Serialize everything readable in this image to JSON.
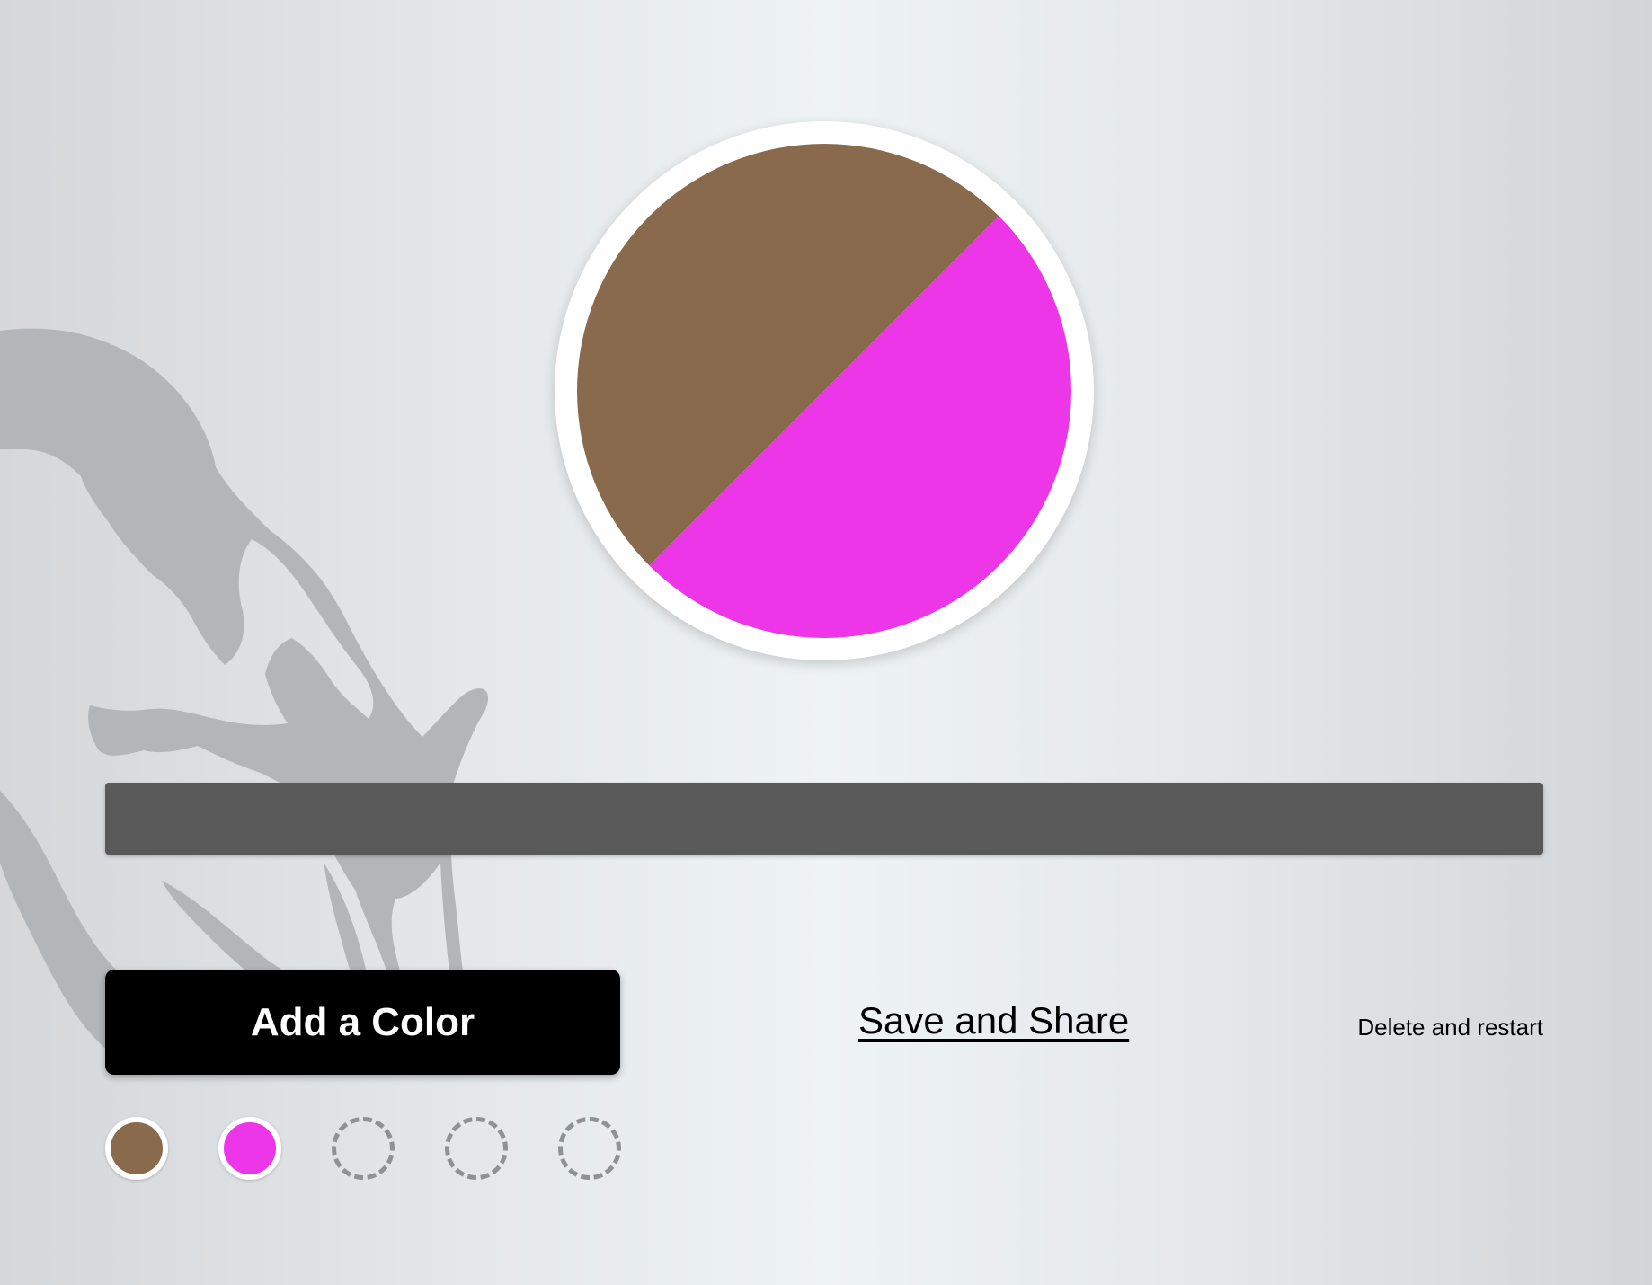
{
  "colors": {
    "brown": "#8a6a4c",
    "magenta": "#ec36e8",
    "bar": "#595959",
    "button_bg": "#000000",
    "button_text": "#ffffff"
  },
  "actions": {
    "add_color_label": "Add a Color",
    "save_share_label": "Save and Share",
    "delete_restart_label": "Delete and restart"
  },
  "swatches": [
    {
      "state": "filled",
      "color": "#8a6a4c"
    },
    {
      "state": "filled",
      "color": "#ec36e8"
    },
    {
      "state": "empty"
    },
    {
      "state": "empty"
    },
    {
      "state": "empty"
    }
  ]
}
